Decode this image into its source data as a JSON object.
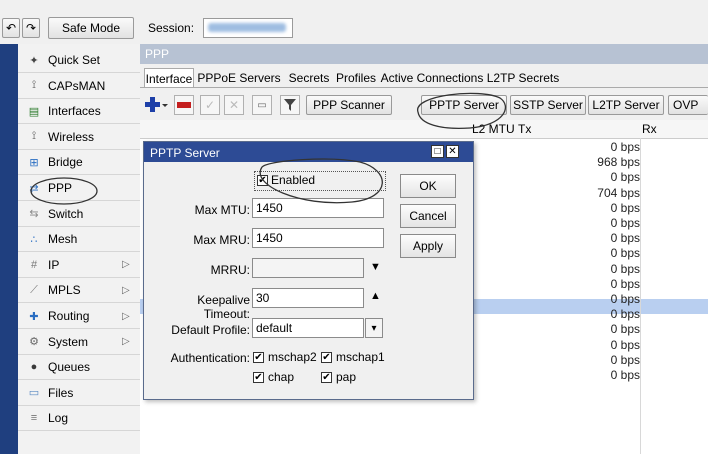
{
  "toolbar": {
    "undo_icon": "undo-icon",
    "redo_icon": "redo-icon",
    "safe_mode_label": "Safe Mode",
    "session_label": "Session:"
  },
  "sidebar": {
    "items": [
      {
        "label": "Quick Set",
        "icon": "wand-icon",
        "submenu": false
      },
      {
        "label": "CAPsMAN",
        "icon": "antenna-icon",
        "submenu": false
      },
      {
        "label": "Interfaces",
        "icon": "interfaces-icon",
        "submenu": false
      },
      {
        "label": "Wireless",
        "icon": "antenna-icon",
        "submenu": false
      },
      {
        "label": "Bridge",
        "icon": "bridge-icon",
        "submenu": false
      },
      {
        "label": "PPP",
        "icon": "ppp-icon",
        "submenu": false
      },
      {
        "label": "Switch",
        "icon": "switch-icon",
        "submenu": false
      },
      {
        "label": "Mesh",
        "icon": "mesh-icon",
        "submenu": false
      },
      {
        "label": "IP",
        "icon": "ip-icon",
        "submenu": true
      },
      {
        "label": "MPLS",
        "icon": "mpls-icon",
        "submenu": true
      },
      {
        "label": "Routing",
        "icon": "routing-icon",
        "submenu": true
      },
      {
        "label": "System",
        "icon": "system-icon",
        "submenu": true
      },
      {
        "label": "Queues",
        "icon": "queues-icon",
        "submenu": false
      },
      {
        "label": "Files",
        "icon": "files-icon",
        "submenu": false
      },
      {
        "label": "Log",
        "icon": "log-icon",
        "submenu": false
      }
    ]
  },
  "ppp_window": {
    "title": "PPP",
    "tabs": [
      "Interface",
      "PPPoE Servers",
      "Secrets",
      "Profiles",
      "Active Connections",
      "L2TP Secrets"
    ],
    "active_tab": "Interface",
    "buttons": {
      "pppoe_scanner": "PPP Scanner",
      "pptp_server": "PPTP Server",
      "sstp_server": "SSTP Server",
      "l2tp_server": "L2TP Server",
      "ovpn_server": "OVP"
    },
    "columns": {
      "mtu": "L2 MTU",
      "tx": "Tx",
      "rx": "Rx"
    },
    "tx_values": [
      "0 bps",
      "968 bps",
      "0 bps",
      "704 bps",
      "0 bps",
      "0 bps",
      "0 bps",
      "0 bps",
      "0 bps",
      "0 bps",
      "0 bps",
      "0 bps",
      "0 bps",
      "0 bps",
      "0 bps",
      "0 bps"
    ]
  },
  "dialog": {
    "title": "PPTP Server",
    "enabled_label": "Enabled",
    "enabled": true,
    "max_mtu_label": "Max MTU:",
    "max_mtu": "1450",
    "max_mru_label": "Max MRU:",
    "max_mru": "1450",
    "mrru_label": "MRRU:",
    "mrru": "",
    "keepalive_label": "Keepalive Timeout:",
    "keepalive": "30",
    "default_profile_label": "Default Profile:",
    "default_profile": "default",
    "authentication_label": "Authentication:",
    "auth": {
      "mschap2": "mschap2",
      "mschap1": "mschap1",
      "chap": "chap",
      "pap": "pap"
    },
    "ok_label": "OK",
    "cancel_label": "Cancel",
    "apply_label": "Apply",
    "restore_icon": "restore-icon",
    "close_icon": "close-icon"
  },
  "colors": {
    "dialog_titlebar": "#2d4b95",
    "sidebar_strip": "#1f3f7f",
    "selected_row": "#b9cff0",
    "plus_button": "#1d3fa8",
    "minus_button": "#c41e1e"
  }
}
